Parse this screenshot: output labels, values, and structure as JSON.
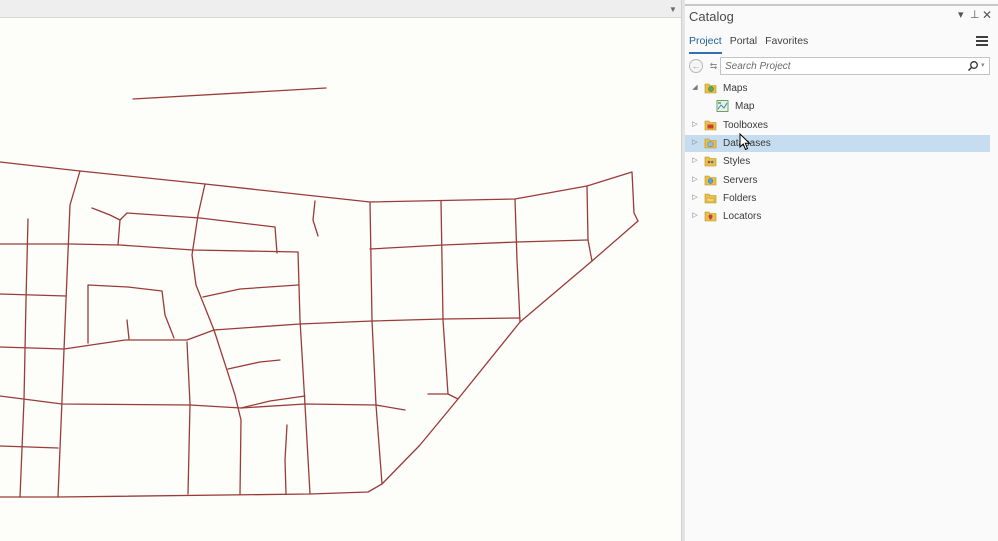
{
  "map": {
    "dropdown_icon": "chevron-down-icon",
    "road_color": "#9a3b38",
    "background_color": "#fdfdfa"
  },
  "catalog": {
    "title": "Catalog",
    "controls": {
      "menu": "▾",
      "pin": "⊥",
      "close": "✕"
    },
    "tabs": [
      {
        "label": "Project",
        "active": true
      },
      {
        "label": "Portal",
        "active": false
      },
      {
        "label": "Favorites",
        "active": false
      }
    ],
    "search": {
      "placeholder": "Search Project",
      "value": ""
    },
    "tree": [
      {
        "label": "Maps",
        "expanded": true,
        "icon": "maps-folder-icon"
      },
      {
        "label": "Map",
        "child": true,
        "icon": "map-icon"
      },
      {
        "label": "Toolboxes",
        "expanded": false,
        "icon": "toolboxes-folder-icon"
      },
      {
        "label": "Databases",
        "expanded": false,
        "selected": true,
        "icon": "databases-folder-icon"
      },
      {
        "label": "Styles",
        "expanded": false,
        "icon": "styles-folder-icon"
      },
      {
        "label": "Servers",
        "expanded": false,
        "icon": "servers-folder-icon"
      },
      {
        "label": "Folders",
        "expanded": false,
        "icon": "folders-folder-icon"
      },
      {
        "label": "Locators",
        "expanded": false,
        "icon": "locators-folder-icon"
      }
    ],
    "accent_color": "#2d73b5",
    "selection_color": "#c6ddf0"
  }
}
